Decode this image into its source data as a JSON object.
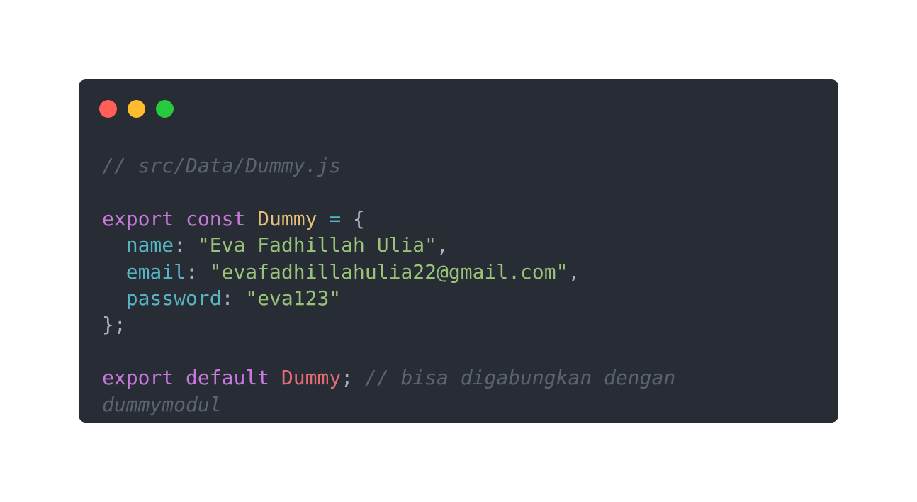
{
  "window": {
    "controls": {
      "close_color": "#ff5f56",
      "minimize_color": "#ffbd2e",
      "maximize_color": "#27c93f"
    }
  },
  "code": {
    "file_comment": "// src/Data/Dummy.js",
    "decl": {
      "kw_export": "export",
      "kw_const": "const",
      "name": "Dummy",
      "equals": "=",
      "open_brace": "{"
    },
    "props": [
      {
        "key": "name",
        "colon": ":",
        "value": "\"Eva Fadhillah Ulia\"",
        "comma": ","
      },
      {
        "key": "email",
        "colon": ":",
        "value": "\"evafadhillahulia22@gmail.com\"",
        "comma": ","
      },
      {
        "key": "password",
        "colon": ":",
        "value": "\"eva123\"",
        "comma": ""
      }
    ],
    "close": "};",
    "export_default": {
      "kw_export": "export",
      "kw_default": "default",
      "name": "Dummy",
      "semicolon": ";",
      "comment_line1": "// bisa digabungkan dengan",
      "comment_line2": "dummymodul"
    }
  }
}
